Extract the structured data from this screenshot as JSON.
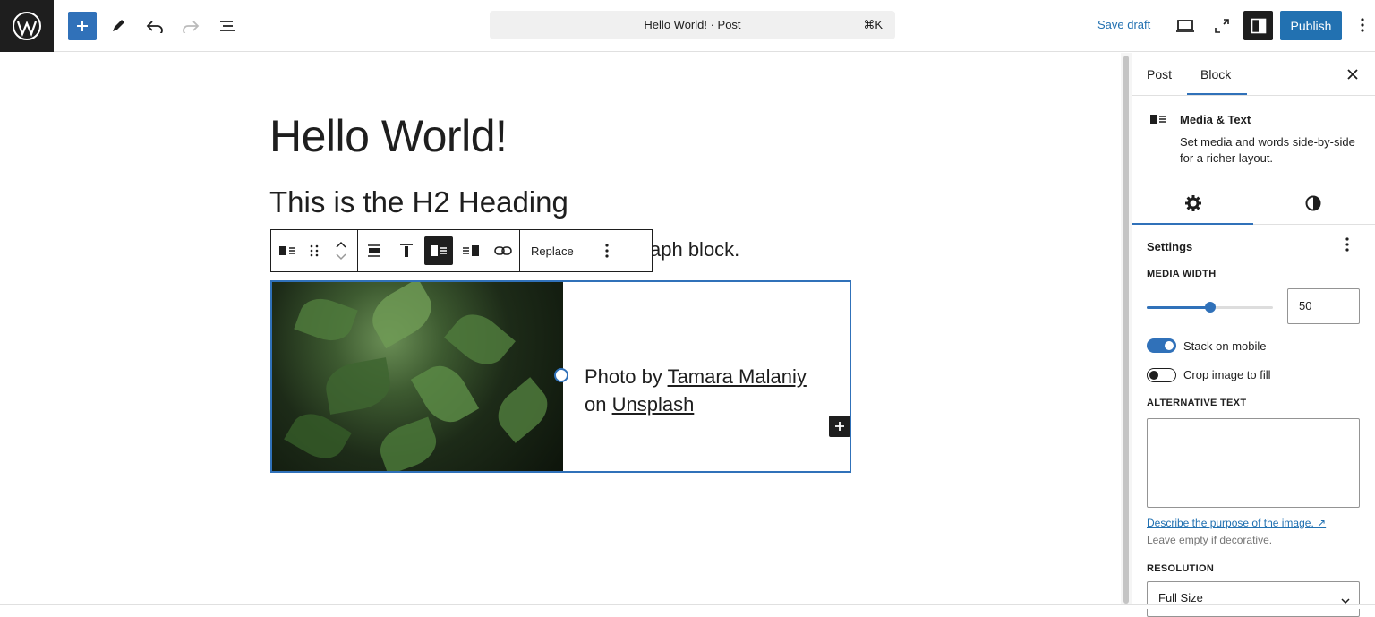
{
  "header": {
    "document_title": "Hello World! · Post",
    "shortcut": "⌘K",
    "save_draft": "Save draft",
    "publish": "Publish"
  },
  "content": {
    "h1": "Hello World!",
    "h2": "This is the H2 Heading",
    "paragraph_visible": "aph block.",
    "media_text": {
      "prefix": "Photo by ",
      "author_link": "Tamara Malaniy",
      "mid": " on ",
      "site_link": "Unsplash"
    }
  },
  "block_toolbar": {
    "replace_label": "Replace"
  },
  "sidebar": {
    "tabs": [
      "Post",
      "Block"
    ],
    "block_title": "Media & Text",
    "block_desc": "Set media and words side-by-side for a richer layout.",
    "settings_title": "Settings",
    "media_width_label": "MEDIA WIDTH",
    "media_width_value": "50",
    "media_width_fraction": 0.5,
    "stack_on_mobile": "Stack on mobile",
    "stack_on_mobile_on": true,
    "crop_image": "Crop image to fill",
    "crop_image_on": false,
    "alt_label": "ALTERNATIVE TEXT",
    "alt_link": "Describe the purpose of the image. ↗",
    "alt_help": "Leave empty if decorative.",
    "resolution_label": "RESOLUTION",
    "resolution_value": "Full Size"
  },
  "colors": {
    "accent": "#3071b9",
    "dark": "#1e1e1e",
    "link": "#2271b1"
  }
}
